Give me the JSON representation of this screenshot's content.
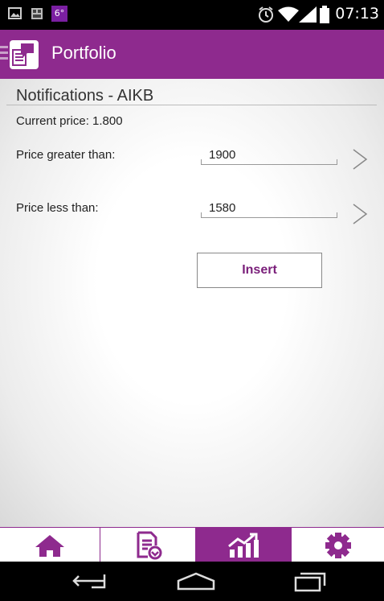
{
  "status_bar": {
    "time": "07:13",
    "temperature": "6°",
    "icons": [
      "image-icon",
      "notification-icon",
      "temperature-icon",
      "alarm-icon",
      "wifi-icon",
      "signal-icon",
      "battery-icon"
    ]
  },
  "action_bar": {
    "title": "Portfolio",
    "color": "#8e2a8e"
  },
  "notifications": {
    "title": "Notifications - AIKB",
    "current_price": "Current price: 1.800",
    "greater_than": {
      "label": "Price greater than:",
      "value": "1900"
    },
    "less_than": {
      "label": "Price less than:",
      "value": "1580"
    },
    "insert_label": "Insert"
  },
  "tab_bar": {
    "tabs": [
      "home-icon",
      "document-icon",
      "chart-icon",
      "settings-icon"
    ],
    "active_index": 2,
    "accent": "#8e2a8e"
  },
  "nav_bar": {
    "buttons": [
      "back-icon",
      "home-outline-icon",
      "recents-icon"
    ]
  }
}
